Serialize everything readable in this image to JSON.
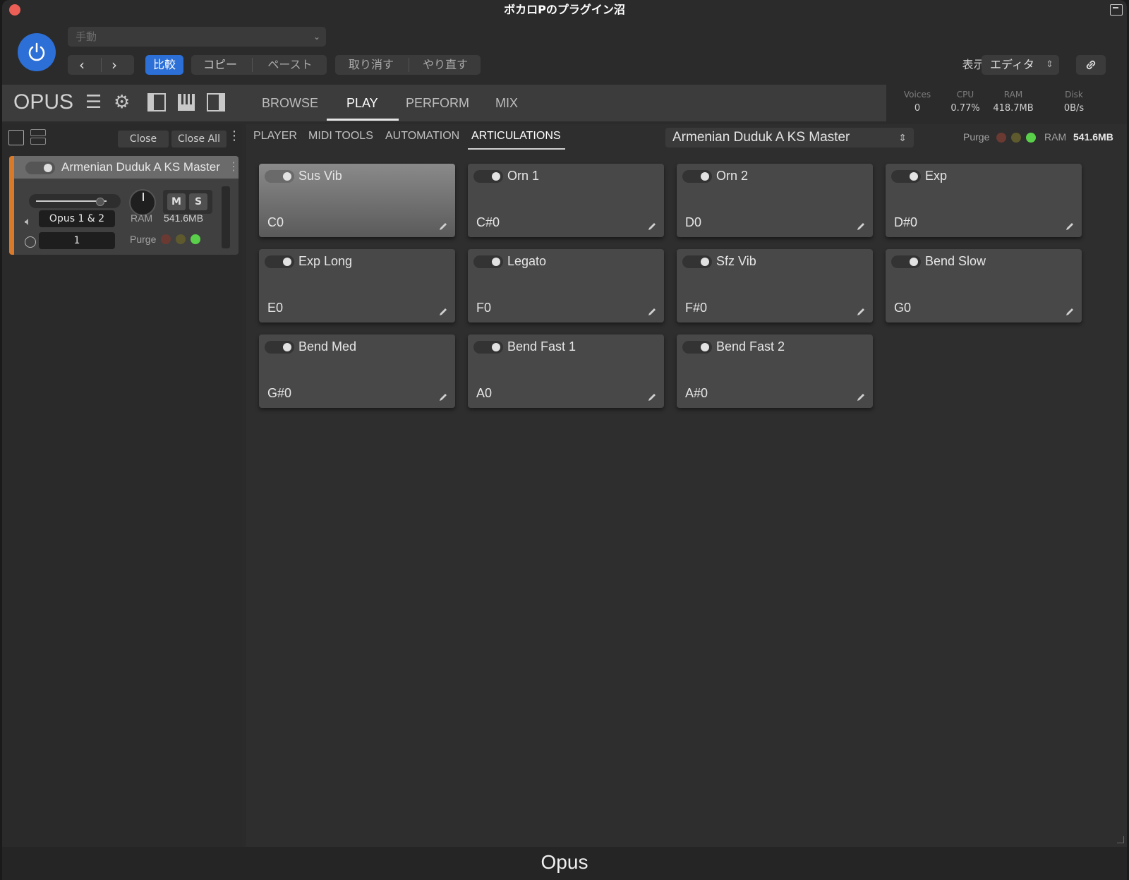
{
  "window": {
    "title": "ボカロPのプラグイン沼"
  },
  "host": {
    "preset_placeholder": "手動",
    "compare_label": "比較",
    "copy_label": "コピー",
    "paste_label": "ペースト",
    "undo_label": "取り消す",
    "redo_label": "やり直す",
    "display_label": "表示:",
    "display_value": "エディタ"
  },
  "opus": {
    "logo": "OPUS",
    "tabs": [
      {
        "label": "BROWSE"
      },
      {
        "label": "PLAY"
      },
      {
        "label": "PERFORM"
      },
      {
        "label": "MIX"
      }
    ],
    "active_tab": "PLAY"
  },
  "stats": {
    "voices_label": "Voices",
    "voices": "0",
    "cpu_label": "CPU",
    "cpu": "0.77%",
    "ram_label": "RAM",
    "ram": "418.7MB",
    "disk_label": "Disk",
    "disk": "0B/s"
  },
  "left_panel": {
    "close_label": "Close",
    "close_all_label": "Close All",
    "instrument": {
      "name": "Armenian Duduk A KS Master",
      "mute_label": "M",
      "solo_label": "S",
      "output": "Opus 1 & 2",
      "midi_channel": "1",
      "ram_label": "RAM",
      "ram_value": "541.6MB",
      "purge_label": "Purge"
    }
  },
  "main": {
    "subtabs": [
      {
        "label": "PLAYER"
      },
      {
        "label": "MIDI TOOLS"
      },
      {
        "label": "AUTOMATION"
      },
      {
        "label": "ARTICULATIONS"
      }
    ],
    "active_subtab": "ARTICULATIONS",
    "articulation_set": "Armenian Duduk A KS Master",
    "purge_label": "Purge",
    "ram_label": "RAM",
    "ram_value": "541.6MB",
    "articulations": [
      {
        "name": "Sus Vib",
        "note": "C0",
        "active": true
      },
      {
        "name": "Orn 1",
        "note": "C#0",
        "active": false
      },
      {
        "name": "Orn 2",
        "note": "D0",
        "active": false
      },
      {
        "name": "Exp",
        "note": "D#0",
        "active": false
      },
      {
        "name": "Exp Long",
        "note": "E0",
        "active": false
      },
      {
        "name": "Legato",
        "note": "F0",
        "active": false
      },
      {
        "name": "Sfz Vib",
        "note": "F#0",
        "active": false
      },
      {
        "name": "Bend Slow",
        "note": "G0",
        "active": false
      },
      {
        "name": "Bend Med",
        "note": "G#0",
        "active": false
      },
      {
        "name": "Bend Fast 1",
        "note": "A0",
        "active": false
      },
      {
        "name": "Bend Fast 2",
        "note": "A#0",
        "active": false
      }
    ]
  },
  "footer": {
    "label": "Opus"
  },
  "colors": {
    "accent_blue": "#2c6fd6",
    "instrument_strip": "#d87a2a",
    "led_red": "#6a3a32",
    "led_yellow": "#5e5a2e",
    "led_green": "#5ad04a"
  }
}
